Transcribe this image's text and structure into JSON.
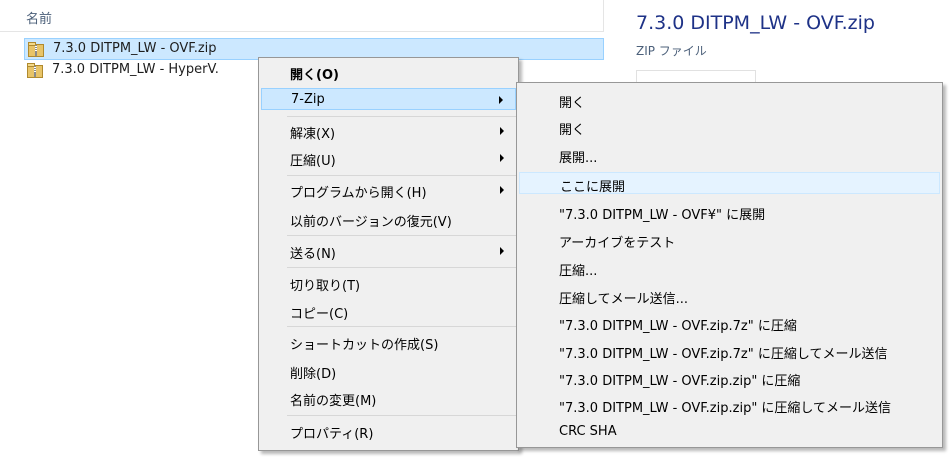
{
  "file_list": {
    "column_header": "名前",
    "files": [
      {
        "name": "7.3.0 DITPM_LW - OVF.zip"
      },
      {
        "name": "7.3.0 DITPM_LW - HyperV."
      }
    ]
  },
  "preview": {
    "title": "7.3.0 DITPM_LW - OVF.zip",
    "type": "ZIP ファイル"
  },
  "context_menu": {
    "items": [
      {
        "label": "開く(O)"
      },
      {
        "label": "7-Zip"
      },
      {
        "label": "解凍(X)"
      },
      {
        "label": "圧縮(U)"
      },
      {
        "label": "プログラムから開く(H)"
      },
      {
        "label": "以前のバージョンの復元(V)"
      },
      {
        "label": "送る(N)"
      },
      {
        "label": "切り取り(T)"
      },
      {
        "label": "コピー(C)"
      },
      {
        "label": "ショートカットの作成(S)"
      },
      {
        "label": "削除(D)"
      },
      {
        "label": "名前の変更(M)"
      },
      {
        "label": "プロパティ(R)"
      }
    ]
  },
  "zip_submenu": {
    "items": [
      {
        "label": "開く"
      },
      {
        "label": "開く"
      },
      {
        "label": "展開..."
      },
      {
        "label": "ここに展開"
      },
      {
        "label": "\"7.3.0 DITPM_LW - OVF¥\" に展開"
      },
      {
        "label": "アーカイブをテスト"
      },
      {
        "label": "圧縮..."
      },
      {
        "label": "圧縮してメール送信..."
      },
      {
        "label": "\"7.3.0 DITPM_LW - OVF.zip.7z\" に圧縮"
      },
      {
        "label": "\"7.3.0 DITPM_LW - OVF.zip.7z\" に圧縮してメール送信"
      },
      {
        "label": "\"7.3.0 DITPM_LW - OVF.zip.zip\" に圧縮"
      },
      {
        "label": "\"7.3.0 DITPM_LW - OVF.zip.zip\" に圧縮してメール送信"
      },
      {
        "label": "CRC SHA"
      }
    ]
  },
  "colors": {
    "selection": "#cce8ff",
    "selection_border": "#99d1ff",
    "menu_bg": "#f0f0f0",
    "hover": "#e5f3ff",
    "preview_title": "#1e3287"
  }
}
